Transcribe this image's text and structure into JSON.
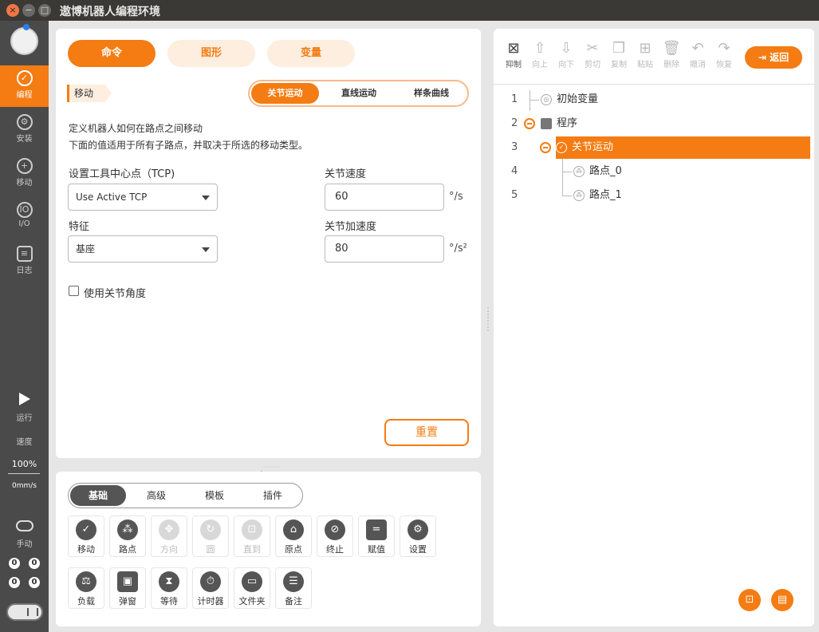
{
  "window": {
    "title": "遨博机器人编程环境"
  },
  "nav": {
    "items": [
      {
        "label": "编程",
        "active": true
      },
      {
        "label": "安装"
      },
      {
        "label": "移动"
      },
      {
        "label": "I/O"
      },
      {
        "label": "日志"
      }
    ],
    "run_label": "运行",
    "speed_label": "速度",
    "speed_value": "100%",
    "speed_mm": "0mm/s",
    "manual_label": "手动",
    "counters": [
      "0",
      "0",
      "0",
      "0"
    ]
  },
  "main": {
    "tabs": [
      "命令",
      "图形",
      "变量"
    ],
    "section_tag": "移动",
    "motion_types": [
      "关节运动",
      "直线运动",
      "样条曲线"
    ],
    "desc_line1": "定义机器人如何在路点之间移动",
    "desc_line2": "下面的值适用于所有子路点，并取决于所选的移动类型。",
    "tcp_label": "设置工具中心点（TCP)",
    "tcp_value": "Use Active TCP",
    "feature_label": "特征",
    "feature_value": "基座",
    "joint_speed_label": "关节速度",
    "joint_speed_value": "60",
    "joint_speed_unit": "°/s",
    "joint_acc_label": "关节加速度",
    "joint_acc_value": "80",
    "joint_acc_unit": "°/s²",
    "use_joint_angle_label": "使用关节角度",
    "use_joint_angle_checked": false,
    "reset_label": "重置"
  },
  "palette": {
    "tabs": [
      "基础",
      "高级",
      "模板",
      "插件"
    ],
    "row1": [
      {
        "label": "移动",
        "icon": "move-icon",
        "enabled": true
      },
      {
        "label": "路点",
        "icon": "waypoint-icon",
        "enabled": true
      },
      {
        "label": "方向",
        "icon": "direction-icon",
        "enabled": false
      },
      {
        "label": "圆",
        "icon": "circle-icon",
        "enabled": false
      },
      {
        "label": "直到",
        "icon": "until-icon",
        "enabled": false
      },
      {
        "label": "原点",
        "icon": "home-icon",
        "enabled": true
      },
      {
        "label": "终止",
        "icon": "stop-icon",
        "enabled": true
      },
      {
        "label": "赋值",
        "icon": "assign-icon",
        "enabled": true
      },
      {
        "label": "设置",
        "icon": "settings-icon",
        "enabled": true
      }
    ],
    "row2": [
      {
        "label": "负载",
        "icon": "payload-icon",
        "enabled": true
      },
      {
        "label": "弹窗",
        "icon": "popup-icon",
        "enabled": true
      },
      {
        "label": "等待",
        "icon": "wait-icon",
        "enabled": true
      },
      {
        "label": "计时器",
        "icon": "timer-icon",
        "enabled": true
      },
      {
        "label": "文件夹",
        "icon": "folder-icon",
        "enabled": true
      },
      {
        "label": "备注",
        "icon": "comment-icon",
        "enabled": true
      }
    ]
  },
  "toolbar": {
    "items": [
      {
        "label": "抑制",
        "enabled": true
      },
      {
        "label": "向上",
        "enabled": false
      },
      {
        "label": "向下",
        "enabled": false
      },
      {
        "label": "剪切",
        "enabled": false
      },
      {
        "label": "复制",
        "enabled": false
      },
      {
        "label": "粘贴",
        "enabled": false
      },
      {
        "label": "删除",
        "enabled": false
      },
      {
        "label": "撤消",
        "enabled": false
      },
      {
        "label": "恢复",
        "enabled": false
      }
    ],
    "back_label": "返回"
  },
  "tree": {
    "rows": [
      {
        "num": "1",
        "label": "初始变量"
      },
      {
        "num": "2",
        "label": "程序"
      },
      {
        "num": "3",
        "label": "关节运动",
        "selected": true
      },
      {
        "num": "4",
        "label": "路点_0"
      },
      {
        "num": "5",
        "label": "路点_1"
      }
    ]
  },
  "colors": {
    "accent": "#f47c13",
    "nav_bg": "#4a4a4a"
  }
}
